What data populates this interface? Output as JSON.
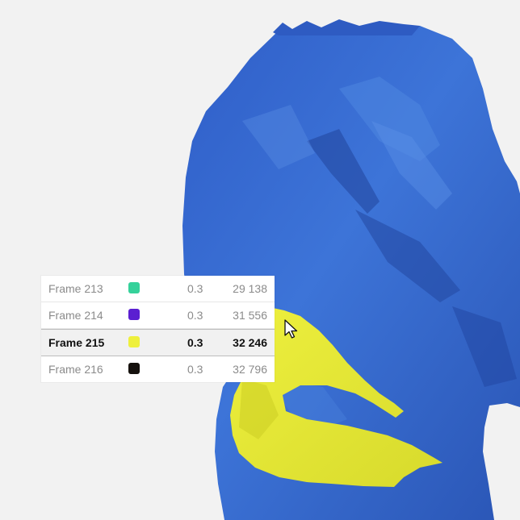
{
  "frames": [
    {
      "name": "Frame 213",
      "color": "#35d19a",
      "opacity": "0.3",
      "count": "29 138",
      "selected": false
    },
    {
      "name": "Frame 214",
      "color": "#5b1fd1",
      "opacity": "0.3",
      "count": "31 556",
      "selected": false
    },
    {
      "name": "Frame 215",
      "color": "#eef03c",
      "opacity": "0.3",
      "count": "32 246",
      "selected": true
    },
    {
      "name": "Frame 216",
      "color": "#15110d",
      "opacity": "0.3",
      "count": "32 796",
      "selected": false
    }
  ],
  "colors": {
    "mesh_blue": "#2f5fc4",
    "mesh_highlight": "#4d85e0",
    "selection_yellow": "#e6ea36",
    "background": "#f2f2f2"
  },
  "icons": {
    "pointer": "mouse-pointer-icon"
  }
}
